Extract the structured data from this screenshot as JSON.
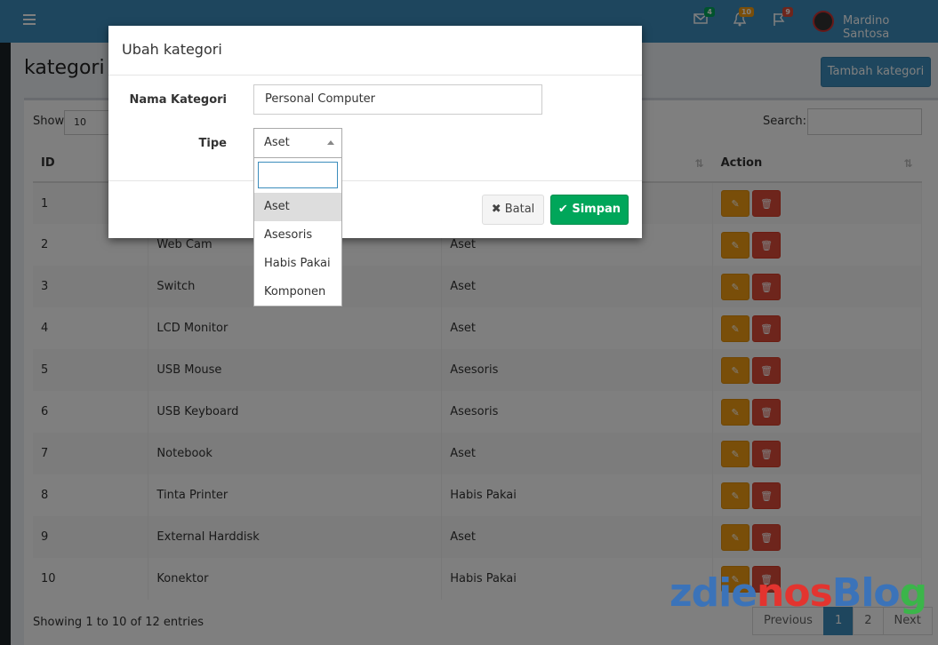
{
  "topbar": {
    "messages_badge": "4",
    "notifications_badge": "10",
    "flags_badge": "9",
    "user_name": "Mardino Santosa"
  },
  "page": {
    "title": "kategori",
    "add_button": "Tambah kategori"
  },
  "table_controls": {
    "show_label": "Show",
    "show_value": "10",
    "search_label": "Search:"
  },
  "table": {
    "headers": [
      "ID",
      "",
      "",
      "Action"
    ],
    "rows": [
      {
        "id": "1",
        "name": "",
        "tipe": ""
      },
      {
        "id": "2",
        "name": "Web Cam",
        "tipe": "Aset"
      },
      {
        "id": "3",
        "name": "Switch",
        "tipe": "Aset"
      },
      {
        "id": "4",
        "name": "LCD Monitor",
        "tipe": "Aset"
      },
      {
        "id": "5",
        "name": "USB Mouse",
        "tipe": "Asesoris"
      },
      {
        "id": "6",
        "name": "USB Keyboard",
        "tipe": "Asesoris"
      },
      {
        "id": "7",
        "name": "Notebook",
        "tipe": "Aset"
      },
      {
        "id": "8",
        "name": "Tinta Printer",
        "tipe": "Habis Pakai"
      },
      {
        "id": "9",
        "name": "External Harddisk",
        "tipe": "Aset"
      },
      {
        "id": "10",
        "name": "Konektor",
        "tipe": "Habis Pakai"
      }
    ]
  },
  "footer": {
    "showing": "Showing 1 to 10 of 12 entries",
    "pager": [
      "Previous",
      "1",
      "2",
      "Next"
    ]
  },
  "modal": {
    "title": "Ubah kategori",
    "nama_label": "Nama Kategori",
    "nama_value": "Personal Computer",
    "tipe_label": "Tipe",
    "tipe_value": "Aset",
    "options": [
      "Aset",
      "Asesoris",
      "Habis Pakai",
      "Komponen"
    ],
    "batal_label": "Batal",
    "simpan_label": "Simpan"
  },
  "watermark": {
    "part1": "zdie",
    "part2": "nos",
    "part3": "Blo",
    "part4": "g"
  }
}
